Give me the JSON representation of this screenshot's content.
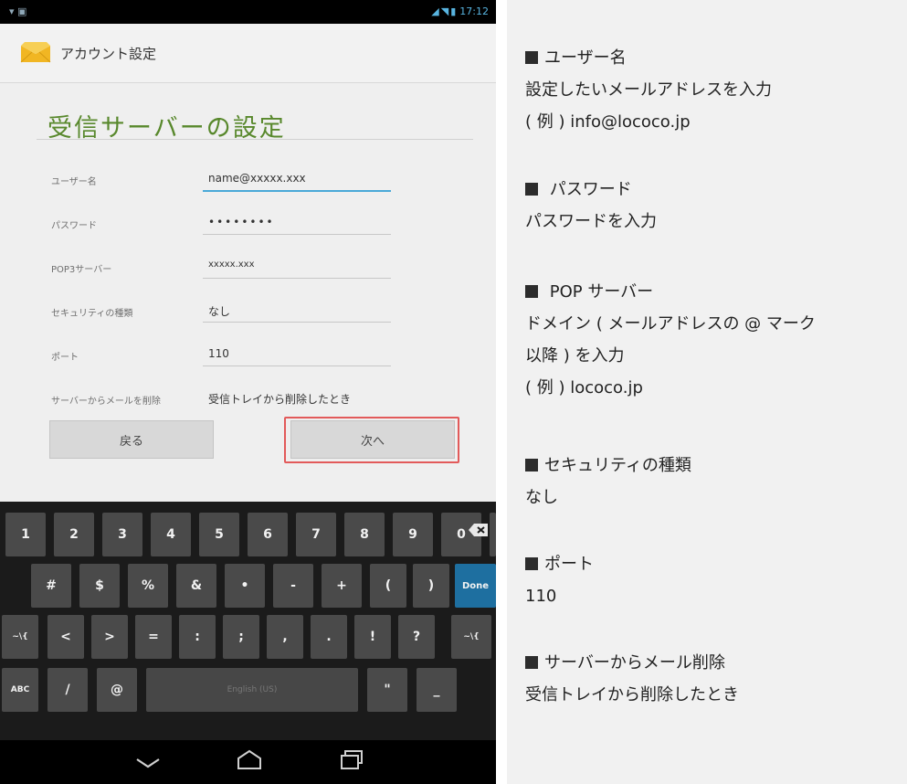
{
  "status_bar": {
    "time": "17:12"
  },
  "action_bar": {
    "title": "アカウント設定"
  },
  "screen": {
    "title": "受信サーバーの設定",
    "fields": [
      {
        "label": "ユーザー名",
        "value": "name@xxxxx.xxx"
      },
      {
        "label": "パスワード",
        "value": "••••••••"
      },
      {
        "label": "POP3サーバー",
        "value": "xxxxx.xxx"
      },
      {
        "label": "セキュリティの種類",
        "value": "なし"
      },
      {
        "label": "ポート",
        "value": "110"
      },
      {
        "label": "サーバーからメールを削除",
        "value": "受信トレイから削除したとき"
      }
    ],
    "back_label": "戻る",
    "next_label": "次へ"
  },
  "keyboard": {
    "row1": [
      "1",
      "2",
      "3",
      "4",
      "5",
      "6",
      "7",
      "8",
      "9",
      "0"
    ],
    "row2": [
      "#",
      "$",
      "%",
      "&",
      "•",
      "-",
      "+",
      "(",
      ")"
    ],
    "row3": [
      "~\\{",
      "<",
      ">",
      "=",
      ":",
      ";",
      ",",
      ".",
      "!",
      "?",
      "~\\{"
    ],
    "row4_left": [
      "ABC",
      "/",
      "@"
    ],
    "row4_right": [
      "\"",
      "_"
    ],
    "done_label": "Done",
    "space_label": "English (US)"
  },
  "info": {
    "blocks": [
      {
        "heading": "ユーザー名",
        "lines": [
          "設定したいメールアドレスを入力",
          "( 例 ) info@lococo.jp"
        ]
      },
      {
        "heading": " パスワード",
        "lines": [
          "パスワードを入力"
        ]
      },
      {
        "heading": " POP サーバー",
        "lines": [
          "ドメイン ( メールアドレスの @ マーク",
          "以降 ) を入力",
          "( 例 ) lococo.jp"
        ]
      },
      {
        "heading": "セキュリティの種類",
        "lines": [
          "なし"
        ]
      },
      {
        "heading": "ポート",
        "lines": [
          "110"
        ]
      },
      {
        "heading": "サーバーからメール削除",
        "lines": [
          "受信トレイから削除したとき"
        ]
      }
    ]
  }
}
